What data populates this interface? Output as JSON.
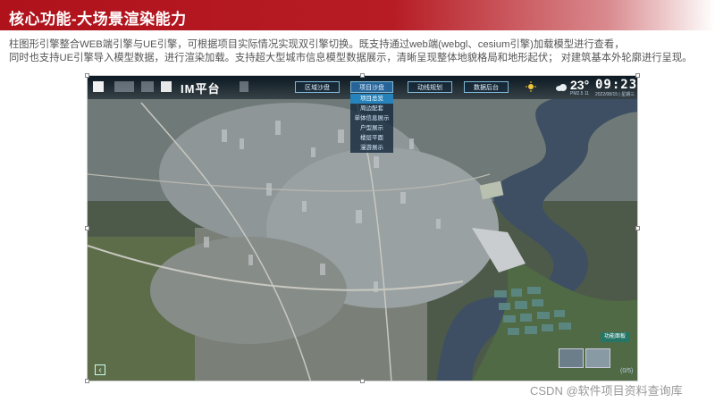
{
  "header": {
    "title": "核心功能-大场景渲染能力",
    "color": "#b0121b"
  },
  "description": {
    "line1": "柱图形引擎整合WEB端引擎与UE引擎，可根据项目实际情况实现双引擎切换。既支持通过web端(webgl、cesium引擎)加载模型进行查看，",
    "line2": "同时也支持UE引擎导入模型数据，进行渲染加载。支持超大型城市信息模型数据展示，清晰呈现整体地貌格局和地形起伏； 对建筑基本外轮廓进行呈现。"
  },
  "app": {
    "platform_title": "IM平台",
    "nav": [
      {
        "label": "区域沙盘"
      },
      {
        "label": "项目沙盘"
      },
      {
        "label": "动线规划"
      },
      {
        "label": "数据后台"
      }
    ],
    "dropdown": [
      "项目总览",
      "周边配套",
      "单体信息展示",
      "户型展示",
      "楼层平面",
      "漫游展示"
    ],
    "weather": {
      "temp": "23°",
      "sub": "PM2.5 11"
    },
    "clock": {
      "time": "09:23:56",
      "date": "2022/08/15 | 星期三"
    },
    "badge": "功能面板",
    "page_indicator": "(0/5)",
    "back_icon": "‹"
  },
  "watermark": "CSDN @软件项目资料查询库"
}
